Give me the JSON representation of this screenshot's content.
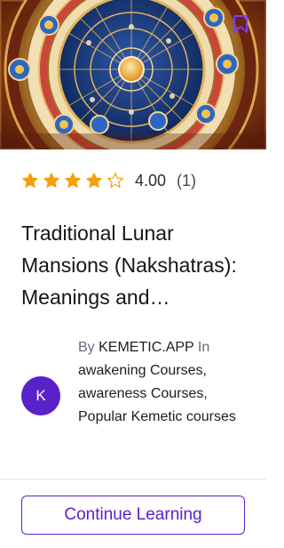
{
  "hero": {
    "image_icon": "zodiac-wheel-image",
    "bookmark_icon": "bookmark-icon"
  },
  "rating": {
    "stars": [
      1,
      1,
      1,
      1,
      0
    ],
    "value": "4.00",
    "count": "(1)",
    "star_color": "#f59e0b"
  },
  "course": {
    "title": "Traditional Lunar Mansions (Nakshatras): Meanings and Applications"
  },
  "author": {
    "avatar_letter": "K",
    "by_label": "By",
    "name": "KEMETIC.APP",
    "in_label": "In",
    "categories": [
      "awakening Courses",
      "awareness Courses",
      "Popular Kemetic courses"
    ],
    "separator": ","
  },
  "actions": {
    "continue_label": "Continue Learning"
  },
  "colors": {
    "accent": "#5b21c9"
  }
}
